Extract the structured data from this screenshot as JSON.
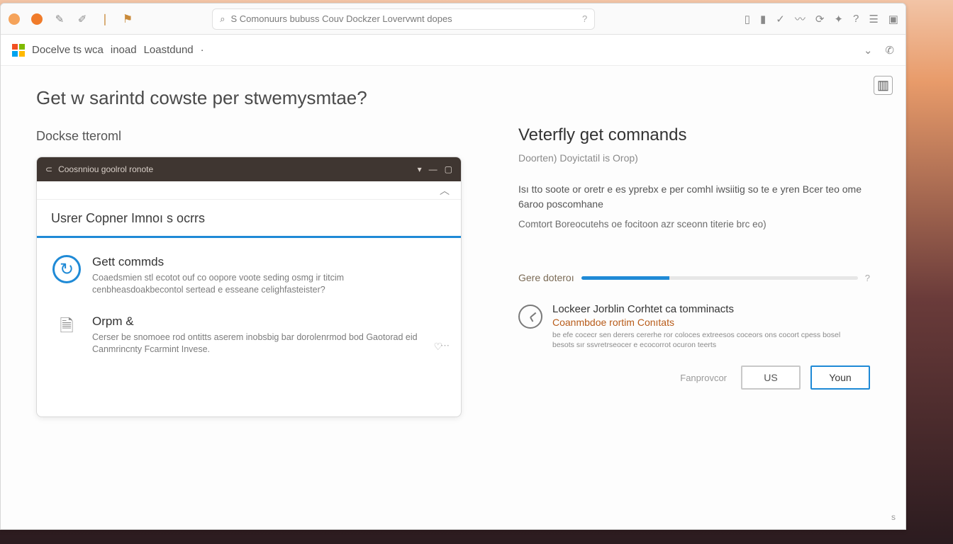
{
  "toolbar": {
    "omnibox_text": "S Comonuurs bubuss Couv Dockzer Lovervwnt dopes"
  },
  "subbar": {
    "crumb1": "Docelve ts wca",
    "crumb2": "inoad",
    "crumb3": "Loastdund",
    "dot": "·"
  },
  "page": {
    "title": "Get w sarintd cowste per stwemysmtae?",
    "subtitle": "Dockse tteroml"
  },
  "terminal": {
    "titlebar": "Coosnniou goolrol ronote",
    "heading": "Usrer Copner Imnoı s ocrrs",
    "option1": {
      "title": "Gett commds",
      "desc": "Coaedsmien stl ecotot ouf co oopore voote seding osmg ir titcim cenbheasdoakbecontol sertead e esseane celighfasteister?"
    },
    "option2": {
      "title": "Orpm &",
      "desc": "Cerser be snomoee rod ontitts aserem inobsbig bar dorolenrmod bod Gaotorad eid Canmrincnty Fcarmint Invese."
    }
  },
  "right": {
    "heading": "Veterfly get comnands",
    "sub": "Doorten) Doyictatil is Orop)",
    "para": "Isı tto soote or oretr e es yprebx e per comhl iwsiitig so te e yren Bcer teo ome 6aroo poscomhane",
    "note": "Comtort Boreocutehs oe focitoon azr sceonn titerie brc eo)",
    "progress_label": "Gere doteroı",
    "callout": {
      "title": "Lockeer Jorblin Corhtet ca tomminacts",
      "sub": "Coanmbdoe rortim Conıtats",
      "small": "be efe cocecr sen derers cererhe ror coloces extreesos coceors ons  cocort cpess bosel besots sır ssvretrseocer e ecocorrot ocuron teerts"
    },
    "ghost": "Fanprovcor",
    "btn_us": "US",
    "btn_youn": "Youn"
  },
  "corner": "s"
}
